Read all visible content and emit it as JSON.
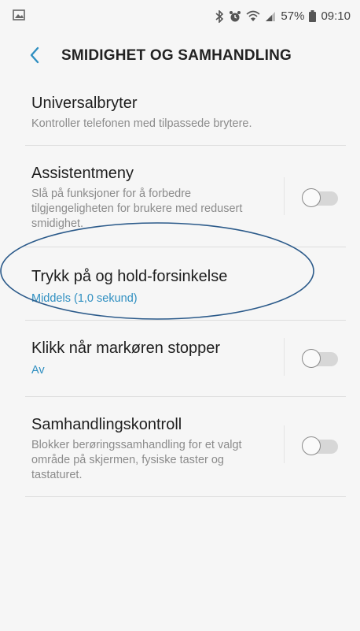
{
  "status_bar": {
    "battery": "57%",
    "time": "09:10"
  },
  "header": {
    "title": "SMIDIGHET OG SAMHANDLING"
  },
  "items": [
    {
      "title": "Universalbryter",
      "subtitle": "Kontroller telefonen med tilpassede brytere."
    },
    {
      "title": "Assistentmeny",
      "subtitle": "Slå på funksjoner for å forbedre tilgjengeligheten for brukere med redusert smidighet.",
      "toggle": "off"
    },
    {
      "title": "Trykk på og hold-forsinkelse",
      "subtitle": "Middels (1,0 sekund)"
    },
    {
      "title": "Klikk når markøren stopper",
      "subtitle": "Av",
      "toggle": "off"
    },
    {
      "title": "Samhandlingskontroll",
      "subtitle": "Blokker berøringssamhandling for et valgt område på skjermen, fysiske taster og tastaturet.",
      "toggle": "off"
    }
  ],
  "colors": {
    "accent": "#2f8fc1",
    "annotation": "#2b5a8a"
  }
}
